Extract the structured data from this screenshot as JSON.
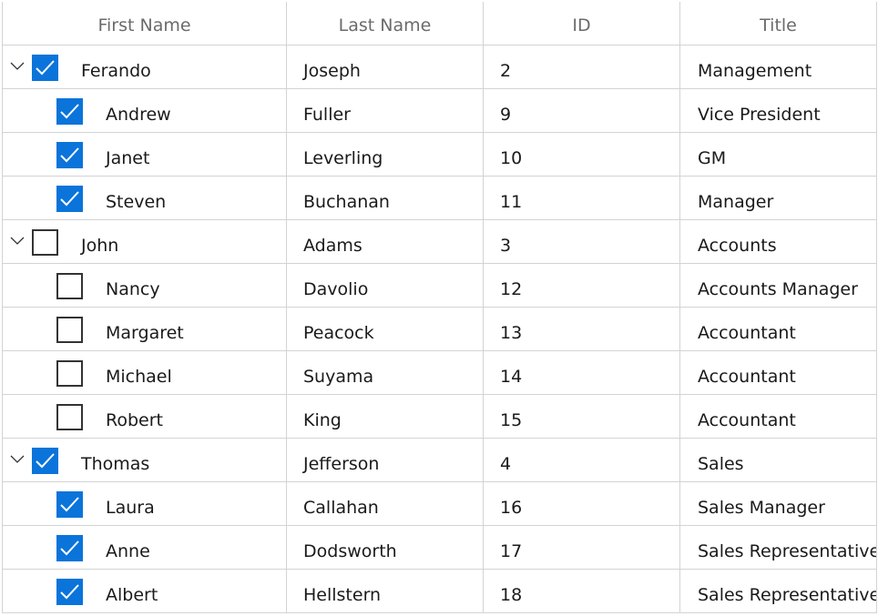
{
  "grid": {
    "columns": [
      "First Name",
      "Last Name",
      "ID",
      "Title"
    ],
    "rows": [
      {
        "first": "Ferando",
        "last": "Joseph",
        "id": "2",
        "title": "Management",
        "parent": true,
        "checked": true
      },
      {
        "first": "Andrew",
        "last": "Fuller",
        "id": "9",
        "title": "Vice President",
        "parent": false,
        "checked": true
      },
      {
        "first": "Janet",
        "last": "Leverling",
        "id": "10",
        "title": "GM",
        "parent": false,
        "checked": true
      },
      {
        "first": "Steven",
        "last": "Buchanan",
        "id": "11",
        "title": "Manager",
        "parent": false,
        "checked": true
      },
      {
        "first": "John",
        "last": "Adams",
        "id": "3",
        "title": "Accounts",
        "parent": true,
        "checked": false
      },
      {
        "first": "Nancy",
        "last": "Davolio",
        "id": "12",
        "title": "Accounts Manager",
        "parent": false,
        "checked": false
      },
      {
        "first": "Margaret",
        "last": "Peacock",
        "id": "13",
        "title": "Accountant",
        "parent": false,
        "checked": false
      },
      {
        "first": "Michael",
        "last": "Suyama",
        "id": "14",
        "title": "Accountant",
        "parent": false,
        "checked": false
      },
      {
        "first": "Robert",
        "last": "King",
        "id": "15",
        "title": "Accountant",
        "parent": false,
        "checked": false
      },
      {
        "first": "Thomas",
        "last": "Jefferson",
        "id": "4",
        "title": "Sales",
        "parent": true,
        "checked": true
      },
      {
        "first": "Laura",
        "last": "Callahan",
        "id": "16",
        "title": "Sales Manager",
        "parent": false,
        "checked": true
      },
      {
        "first": "Anne",
        "last": "Dodsworth",
        "id": "17",
        "title": "Sales Representative",
        "parent": false,
        "checked": true
      },
      {
        "first": "Albert",
        "last": "Hellstern",
        "id": "18",
        "title": "Sales Representative",
        "parent": false,
        "checked": true
      }
    ]
  },
  "colors": {
    "checkbox_accent": "#0a74da",
    "gridline": "#d3d3d3",
    "header_text": "#6b6b6b"
  },
  "icons": {
    "expander": "chevron-down-icon",
    "check": "checkmark-icon"
  }
}
